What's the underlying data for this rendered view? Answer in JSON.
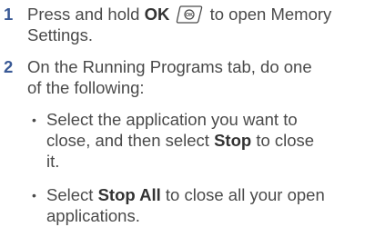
{
  "steps": [
    {
      "number": "1",
      "text_a": "Press and hold ",
      "bold_a": "OK",
      "icon": "ok-button-icon",
      "text_b": " to open Memory",
      "text_c": "Settings."
    },
    {
      "number": "2",
      "line1": "On the Running Programs tab, do one",
      "line2": "of the following:",
      "bullets": [
        {
          "l1": "Select the application you want to",
          "l2a": "close, and then select ",
          "l2bold": "Stop",
          "l2b": " to close",
          "l3": "it."
        },
        {
          "l1a": "Select ",
          "l1bold": "Stop All",
          "l1b": " to close all your open",
          "l2": "applications."
        }
      ]
    }
  ],
  "bullet_glyph": "•",
  "colors": {
    "step_number": "#3a5a96",
    "body_text": "#4a4a4a"
  }
}
